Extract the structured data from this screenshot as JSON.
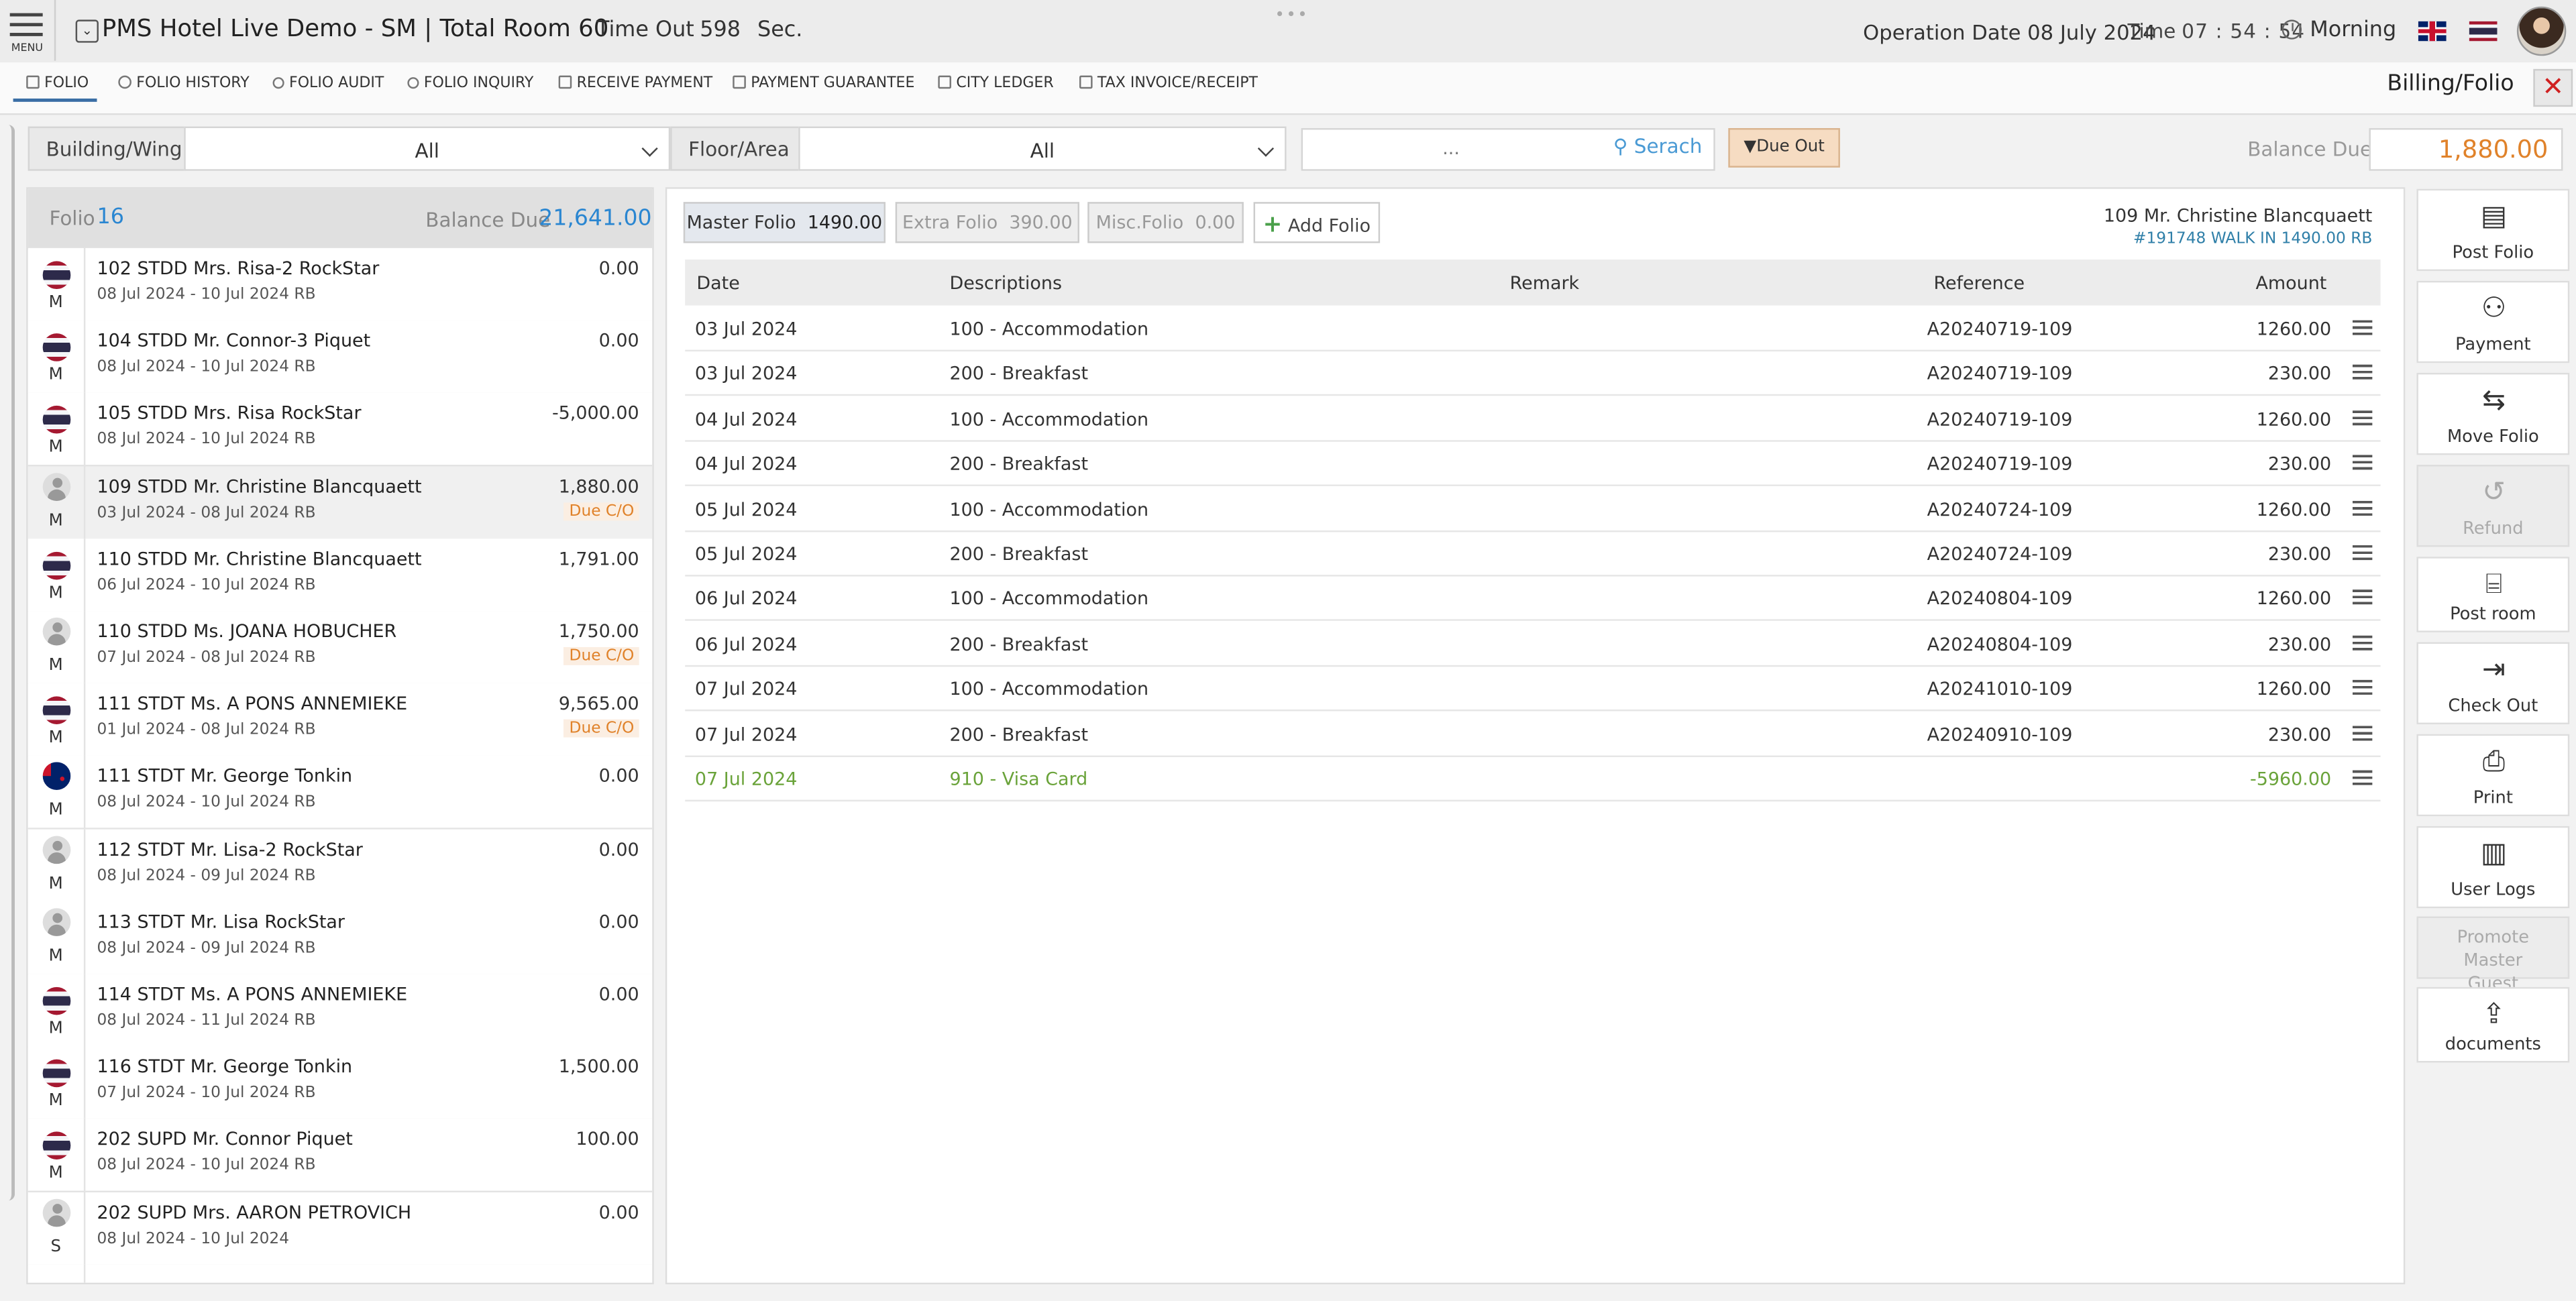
{
  "header": {
    "menu_label": "MENU",
    "app_title": "PMS Hotel Live Demo - SM | Total Room 60",
    "timeout_label": "Time Out",
    "timeout_value": "598",
    "timeout_unit": "Sec.",
    "operation_date": "Operation Date 08 July 2024",
    "time_label": "Time",
    "time_value": "07 : 54 : 54",
    "shift": "Morning"
  },
  "tabs": [
    {
      "label": "FOLIO"
    },
    {
      "label": "FOLIO HISTORY"
    },
    {
      "label": "FOLIO AUDIT"
    },
    {
      "label": "FOLIO INQUIRY"
    },
    {
      "label": "RECEIVE PAYMENT"
    },
    {
      "label": "PAYMENT GUARANTEE"
    },
    {
      "label": "CITY LEDGER"
    },
    {
      "label": "TAX INVOICE/RECEIPT"
    }
  ],
  "page_crumb": "Billing/Folio",
  "close_label": "✕",
  "filters": {
    "building_label": "Building/Wing",
    "building_value": "All",
    "floor_label": "Floor/Area",
    "floor_value": "All",
    "search_placeholder": "...",
    "search_button": "Serach",
    "due_out_button": "Due Out",
    "balance_due_label": "Balance Due",
    "balance_due_value": "1,880.00"
  },
  "guest_list": {
    "folio_label": "Folio",
    "folio_count": "16",
    "balance_due_label": "Balance Due",
    "balance_due_value": "21,641.00",
    "items": [
      {
        "name": "102 STDD Mrs. Risa-2 RockStar",
        "dates": "08 Jul 2024 - 10 Jul 2024 RB",
        "amount": "0.00",
        "tag": "",
        "type": "M",
        "flag": "th"
      },
      {
        "name": "104 STDD Mr. Connor-3 Piquet",
        "dates": "08 Jul 2024 - 10 Jul 2024 RB",
        "amount": "0.00",
        "tag": "",
        "type": "M",
        "flag": "th"
      },
      {
        "name": "105 STDD Mrs. Risa RockStar",
        "dates": "08 Jul 2024 - 10 Jul 2024 RB",
        "amount": "-5,000.00",
        "tag": "",
        "type": "M",
        "flag": "th"
      },
      {
        "name": "109 STDD Mr. Christine Blancquaett",
        "dates": "03 Jul 2024 - 08 Jul 2024 RB",
        "amount": "1,880.00",
        "tag": "Due C/O",
        "type": "M",
        "flag": "person"
      },
      {
        "name": "110 STDD Mr. Christine Blancquaett",
        "dates": "06 Jul 2024 - 10 Jul 2024 RB",
        "amount": "1,791.00",
        "tag": "",
        "type": "M",
        "flag": "th"
      },
      {
        "name": "110 STDD Ms. JOANA HOBUCHER",
        "dates": "07 Jul 2024 - 08 Jul 2024 RB",
        "amount": "1,750.00",
        "tag": "Due C/O",
        "type": "M",
        "flag": "person"
      },
      {
        "name": "111 STDT Ms. A PONS ANNEMIEKE",
        "dates": "01 Jul 2024 - 08 Jul 2024 RB",
        "amount": "9,565.00",
        "tag": "Due C/O",
        "type": "M",
        "flag": "th"
      },
      {
        "name": "111 STDT Mr. George Tonkin",
        "dates": "08 Jul 2024 - 10 Jul 2024 RB",
        "amount": "0.00",
        "tag": "",
        "type": "M",
        "flag": "nz"
      },
      {
        "name": "112 STDT Mr. Lisa-2 RockStar",
        "dates": "08 Jul 2024 - 09 Jul 2024 RB",
        "amount": "0.00",
        "tag": "",
        "type": "M",
        "flag": "person"
      },
      {
        "name": "113 STDT Mr. Lisa RockStar",
        "dates": "08 Jul 2024 - 09 Jul 2024 RB",
        "amount": "0.00",
        "tag": "",
        "type": "M",
        "flag": "person"
      },
      {
        "name": "114 STDT Ms. A PONS ANNEMIEKE",
        "dates": "08 Jul 2024 - 11 Jul 2024 RB",
        "amount": "0.00",
        "tag": "",
        "type": "M",
        "flag": "th"
      },
      {
        "name": "116 STDT Mr. George Tonkin",
        "dates": "07 Jul 2024 - 10 Jul 2024 RB",
        "amount": "1,500.00",
        "tag": "",
        "type": "M",
        "flag": "th"
      },
      {
        "name": "202 SUPD Mr. Connor Piquet",
        "dates": "08 Jul 2024 - 10 Jul 2024 RB",
        "amount": "100.00",
        "tag": "",
        "type": "M",
        "flag": "th"
      },
      {
        "name": "202 SUPD Mrs. AARON PETROVICH",
        "dates": "08 Jul 2024 - 10 Jul 2024",
        "amount": "0.00",
        "tag": "",
        "type": "S",
        "flag": "person"
      }
    ]
  },
  "folio_tabs": {
    "master_label": "Master Folio",
    "master_value": "1490.00",
    "extra_label": "Extra Folio",
    "extra_value": "390.00",
    "misc_label": "Misc.Folio",
    "misc_value": "0.00",
    "add_label": "Add Folio"
  },
  "guest_header": {
    "title": "109 Mr. Christine Blancquaett",
    "subtitle": "#191748 WALK IN 1490.00 RB"
  },
  "table": {
    "headers": {
      "date": "Date",
      "descriptions": "Descriptions",
      "remark": "Remark",
      "reference": "Reference",
      "amount": "Amount"
    },
    "rows": [
      {
        "date": "03 Jul 2024",
        "desc": "100 - Accommodation",
        "remark": "",
        "ref": "A20240719-109",
        "amount": "1260.00",
        "payment": false
      },
      {
        "date": "03 Jul 2024",
        "desc": "200 - Breakfast",
        "remark": "",
        "ref": "A20240719-109",
        "amount": "230.00",
        "payment": false
      },
      {
        "date": "04 Jul 2024",
        "desc": "100 - Accommodation",
        "remark": "",
        "ref": "A20240719-109",
        "amount": "1260.00",
        "payment": false
      },
      {
        "date": "04 Jul 2024",
        "desc": "200 - Breakfast",
        "remark": "",
        "ref": "A20240719-109",
        "amount": "230.00",
        "payment": false
      },
      {
        "date": "05 Jul 2024",
        "desc": "100 - Accommodation",
        "remark": "",
        "ref": "A20240724-109",
        "amount": "1260.00",
        "payment": false
      },
      {
        "date": "05 Jul 2024",
        "desc": "200 - Breakfast",
        "remark": "",
        "ref": "A20240724-109",
        "amount": "230.00",
        "payment": false
      },
      {
        "date": "06 Jul 2024",
        "desc": "100 - Accommodation",
        "remark": "",
        "ref": "A20240804-109",
        "amount": "1260.00",
        "payment": false
      },
      {
        "date": "06 Jul 2024",
        "desc": "200 - Breakfast",
        "remark": "",
        "ref": "A20240804-109",
        "amount": "230.00",
        "payment": false
      },
      {
        "date": "07 Jul 2024",
        "desc": "100 - Accommodation",
        "remark": "",
        "ref": "A20241010-109",
        "amount": "1260.00",
        "payment": false
      },
      {
        "date": "07 Jul 2024",
        "desc": "200 - Breakfast",
        "remark": "",
        "ref": "A20240910-109",
        "amount": "230.00",
        "payment": false
      },
      {
        "date": "07 Jul 2024",
        "desc": "910 - Visa Card",
        "remark": "",
        "ref": "",
        "amount": "-5960.00",
        "payment": true
      }
    ]
  },
  "actions": [
    {
      "label": "Post Folio",
      "icon": "post-folio-icon",
      "disabled": false
    },
    {
      "label": "Payment",
      "icon": "payment-icon",
      "disabled": false
    },
    {
      "label": "Move Folio",
      "icon": "move-folio-icon",
      "disabled": false
    },
    {
      "label": "Refund",
      "icon": "refund-icon",
      "disabled": true
    },
    {
      "label": "Post room",
      "icon": "bed-icon",
      "disabled": false
    },
    {
      "label": "Check Out",
      "icon": "check-out-icon",
      "disabled": false
    },
    {
      "label": "Print",
      "icon": "printer-icon",
      "disabled": false
    },
    {
      "label": "User Logs",
      "icon": "book-icon",
      "disabled": false
    },
    {
      "label": "Promote Master Guest",
      "icon": "",
      "disabled": true
    },
    {
      "label": "documents",
      "icon": "image-upload-icon",
      "disabled": false
    }
  ],
  "colors": {
    "accent_blue": "#2a86d1",
    "due_orange": "#e0822a",
    "payment_green": "#6aa33a",
    "close_red": "#d02020"
  }
}
